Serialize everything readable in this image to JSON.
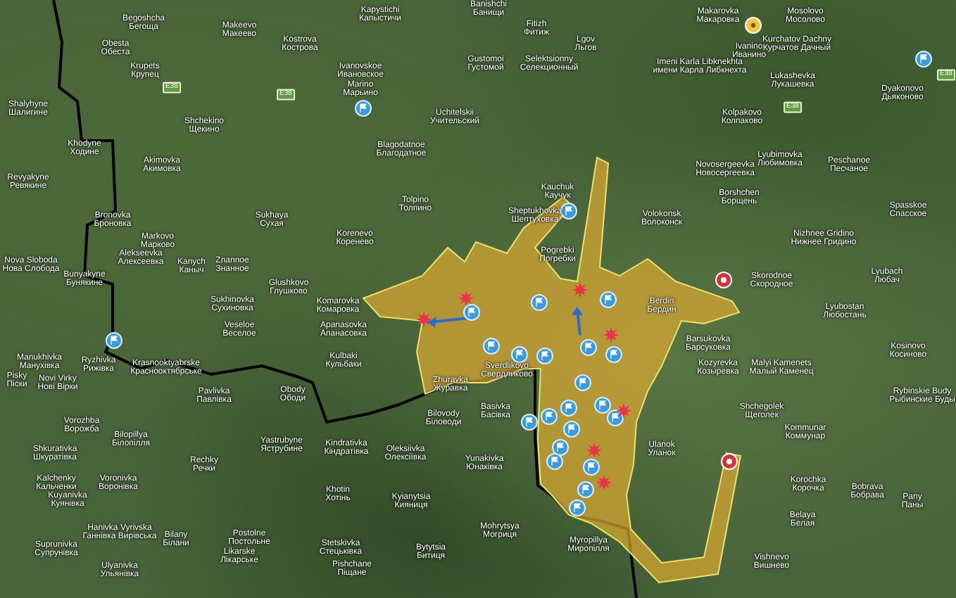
{
  "map": {
    "places": [
      {
        "name": "Begoshcha",
        "local": "Бегоща"
      },
      {
        "name": "Makeevo",
        "local": "Макеево"
      },
      {
        "name": "Obesta",
        "local": "Обеста"
      },
      {
        "name": "Kostrova",
        "local": "Кострова"
      },
      {
        "name": "Krupets",
        "local": "Крупец"
      },
      {
        "name": "Shalyhyne",
        "local": "Шалигине"
      },
      {
        "name": "Shchekino",
        "local": "Щекино"
      },
      {
        "name": "Khodyne",
        "local": "Ходине"
      },
      {
        "name": "Akimovka",
        "local": "Акимовка"
      },
      {
        "name": "Revyakyne",
        "local": "Ревякине"
      },
      {
        "name": "Bronovka",
        "local": "Броновка"
      },
      {
        "name": "Sukhaya",
        "local": "Сухая"
      },
      {
        "name": "Markovo",
        "local": "Марково"
      },
      {
        "name": "Alekseevka",
        "local": "Алексеевка"
      },
      {
        "name": "Nova Sloboda",
        "local": "Нова Слобода"
      },
      {
        "name": "Kanych",
        "local": "Каныч"
      },
      {
        "name": "Znannoe",
        "local": "Знанное"
      },
      {
        "name": "Bunyakyne",
        "local": "Бунякине"
      },
      {
        "name": "Glushkovo",
        "local": "Глушково"
      },
      {
        "name": "Kapystichi",
        "local": "Капыстичи"
      },
      {
        "name": "Banishchi",
        "local": "Банищи"
      },
      {
        "name": "Fitizh",
        "local": "Фитиж"
      },
      {
        "name": "Lgov",
        "local": "Льгов"
      },
      {
        "name": "Gustomoi",
        "local": "Густомой"
      },
      {
        "name": "Selektsionny",
        "local": "Селекционный"
      },
      {
        "name": "Ivanovskoe",
        "local": "Ивановское"
      },
      {
        "name": "Marino",
        "local": "Марьино"
      },
      {
        "name": "Uchitelskii",
        "local": "Учительский"
      },
      {
        "name": "Blagodatnoe",
        "local": "Благодатное"
      },
      {
        "name": "Tolpino",
        "local": "Толпино"
      },
      {
        "name": "Korenevo",
        "local": "Коренево"
      },
      {
        "name": "Kauchuk",
        "local": "Каучук"
      },
      {
        "name": "Sheptukhovka",
        "local": "Шептуховка"
      },
      {
        "name": "Pogrebki",
        "local": "Погребки"
      },
      {
        "name": "Makarovka",
        "local": "Макаровка"
      },
      {
        "name": "Mosolovo",
        "local": "Мосолово"
      },
      {
        "name": "Ivanino",
        "local": "Иванино"
      },
      {
        "name": "Kurchatov Dachny",
        "local": "Курчатов Дачный"
      },
      {
        "name": "Imeni Karla Libknekhta",
        "local": "имени Карла Либкнехта"
      },
      {
        "name": "Lukashevka",
        "local": "Лукашевка"
      },
      {
        "name": "Dyakonovo",
        "local": "Дьяконово"
      },
      {
        "name": "Kolpakovo",
        "local": "Колпаково"
      },
      {
        "name": "Lyubimovka",
        "local": "Любимовка"
      },
      {
        "name": "Novosergeevka",
        "local": "Новосергеевка"
      },
      {
        "name": "Peschanoe",
        "local": "Песчаное"
      },
      {
        "name": "Borshchen",
        "local": "Борщень"
      },
      {
        "name": "Volokonsk",
        "local": "Волоконск"
      },
      {
        "name": "Spasskoe",
        "local": "Спасское"
      },
      {
        "name": "Nizhnee Gridino",
        "local": "Нижнее Гридино"
      },
      {
        "name": "Skorodnoe",
        "local": "Скородное"
      },
      {
        "name": "Lyubach",
        "local": "Любач"
      },
      {
        "name": "Sukhinovka",
        "local": "Сухиновка"
      },
      {
        "name": "Veseloe",
        "local": "Веселое"
      },
      {
        "name": "Manukhivka",
        "local": "Манухівка"
      },
      {
        "name": "Ryzhivka",
        "local": "Рижівка"
      },
      {
        "name": "Krasnooktyabrske",
        "local": "Краснооктябрське"
      },
      {
        "name": "Pavlivka",
        "local": "Павлівка"
      },
      {
        "name": "Obody",
        "local": "Ободи"
      },
      {
        "name": "Pisky",
        "local": "Піски"
      },
      {
        "name": "Novi Virky",
        "local": "Нові Вірки"
      },
      {
        "name": "Vorozhba",
        "local": "Ворожба"
      },
      {
        "name": "Bilopillya",
        "local": "Білопілля"
      },
      {
        "name": "Yastrubyne",
        "local": "Яструбине"
      },
      {
        "name": "Shkurativka",
        "local": "Шкуратівка"
      },
      {
        "name": "Rechky",
        "local": "Речки"
      },
      {
        "name": "Kalchenky",
        "local": "Кальченки"
      },
      {
        "name": "Voronivka",
        "local": "Воронівка"
      },
      {
        "name": "Kuyanivka",
        "local": "Куянівка"
      },
      {
        "name": "Hanivka Vyrivska",
        "local": "Ганнівка Вирівська"
      },
      {
        "name": "Bilany",
        "local": "Білани"
      },
      {
        "name": "Postolne",
        "local": "Постольне"
      },
      {
        "name": "Suprunivka",
        "local": "Супрунівка"
      },
      {
        "name": "Likarske",
        "local": "Лікарське"
      },
      {
        "name": "Ulyanivka",
        "local": "Ульянівка"
      },
      {
        "name": "Komarovka",
        "local": "Комаровка"
      },
      {
        "name": "Apanasovka",
        "local": "Апанасовка"
      },
      {
        "name": "Kulbaki",
        "local": "Кульбаки"
      },
      {
        "name": "Zhuravka",
        "local": "Журавка"
      },
      {
        "name": "Basivka",
        "local": "Басівка"
      },
      {
        "name": "Bilovody",
        "local": "Біловоди"
      },
      {
        "name": "Kindrativka",
        "local": "Кіндратівка"
      },
      {
        "name": "Oleksiivka",
        "local": "Олексіївка"
      },
      {
        "name": "Yunakivka",
        "local": "Юнаківка"
      },
      {
        "name": "Khotin",
        "local": "Хотінь"
      },
      {
        "name": "Kyianytsia",
        "local": "Кияниця"
      },
      {
        "name": "Mohrytsya",
        "local": "Могриця"
      },
      {
        "name": "Stetskivka",
        "local": "Стецьківка"
      },
      {
        "name": "Bytytsia",
        "local": "Битиця"
      },
      {
        "name": "Pishchane",
        "local": "Піщане"
      },
      {
        "name": "Myropillya",
        "local": "Миропілля"
      },
      {
        "name": "Sverdlikovo",
        "local": "Свердликово"
      },
      {
        "name": "Berdin",
        "local": "Бердин"
      },
      {
        "name": "Lyubostan",
        "local": "Любостань"
      },
      {
        "name": "Barsukovka",
        "local": "Барсуковка"
      },
      {
        "name": "Kozyrevka",
        "local": "Козыревка"
      },
      {
        "name": "Malyi Kamenets",
        "local": "Малый Каменец"
      },
      {
        "name": "Kosinovo",
        "local": "Косиново"
      },
      {
        "name": "Rybinskie Budy",
        "local": "Рыбинские Буды"
      },
      {
        "name": "Shchegolek",
        "local": "Щеголек"
      },
      {
        "name": "Kommunar",
        "local": "Коммунар"
      },
      {
        "name": "Ulanok",
        "local": "Уланок"
      },
      {
        "name": "Korochka",
        "local": "Корочка"
      },
      {
        "name": "Bobrava",
        "local": "Бобрава"
      },
      {
        "name": "Pany",
        "local": "Паны"
      },
      {
        "name": "Belaya",
        "local": "Белая"
      },
      {
        "name": "Vishnevo",
        "local": "Вишнево"
      }
    ],
    "road_signs": [
      {
        "label": "E38"
      },
      {
        "label": "E38"
      },
      {
        "label": "E38"
      },
      {
        "label": "E38"
      }
    ]
  }
}
